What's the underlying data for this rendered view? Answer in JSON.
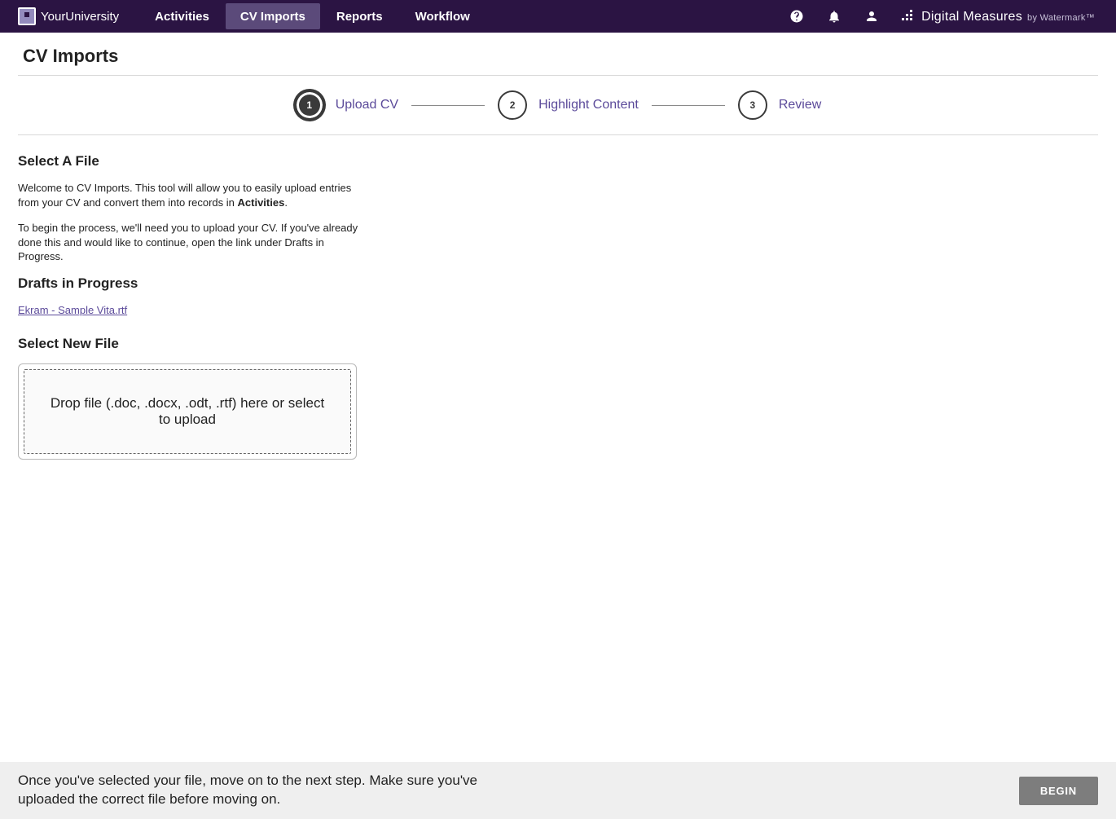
{
  "header": {
    "brand": "YourUniversity",
    "nav": [
      {
        "label": "Activities",
        "active": false
      },
      {
        "label": "CV Imports",
        "active": true
      },
      {
        "label": "Reports",
        "active": false
      },
      {
        "label": "Workflow",
        "active": false
      }
    ],
    "product": {
      "name": "Digital Measures",
      "byline": "by Watermark™"
    }
  },
  "page": {
    "title": "CV Imports",
    "stepper": {
      "steps": [
        {
          "num": "1",
          "label": "Upload CV",
          "active": true
        },
        {
          "num": "2",
          "label": "Highlight Content",
          "active": false
        },
        {
          "num": "3",
          "label": "Review",
          "active": false
        }
      ]
    },
    "select_file_heading": "Select A File",
    "intro1_before": "Welcome to CV Imports. This tool will allow you to easily upload entries from your CV and convert them into records in ",
    "intro1_bold": "Activities",
    "intro1_after": ".",
    "intro2": "To begin the process, we'll need you to upload your CV. If you've already done this and would like to continue, open the link under Drafts in Progress.",
    "drafts_heading": "Drafts in Progress",
    "drafts": [
      {
        "label": "Ekram - Sample Vita.rtf"
      }
    ],
    "select_new_heading": "Select New File",
    "dropzone_text": "Drop file (.doc, .docx, .odt, .rtf) here or select to upload"
  },
  "footer": {
    "hint": "Once you've selected your file, move on to the next step. Make sure you've uploaded the correct file before moving on.",
    "button": "BEGIN"
  }
}
